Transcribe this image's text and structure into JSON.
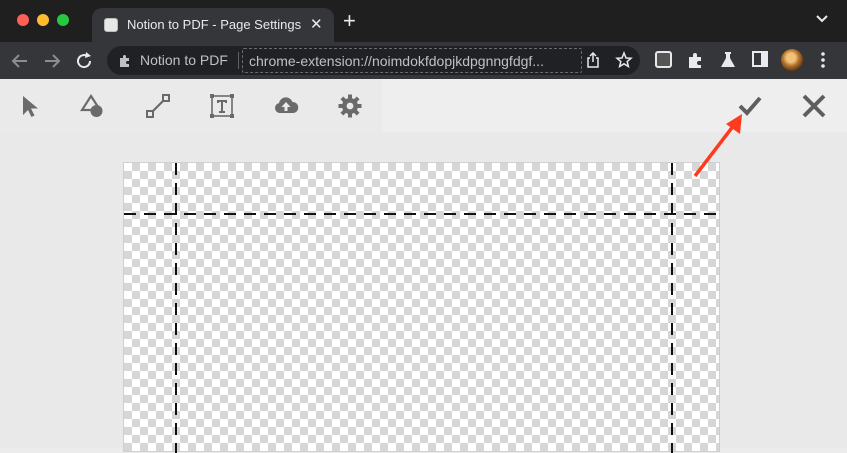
{
  "browser": {
    "tab": {
      "title": "Notion to PDF - Page Settings"
    },
    "omnibox": {
      "site_chip": "Notion to PDF",
      "url": "chrome-extension://noimdokfdopjkdpgnngfdgf..."
    }
  },
  "app_toolbar": {
    "tools": [
      {
        "name": "select-tool",
        "icon": "cursor-arrow-icon"
      },
      {
        "name": "shape-tool",
        "icon": "shapes-icon"
      },
      {
        "name": "line-tool",
        "icon": "line-icon"
      },
      {
        "name": "text-tool",
        "icon": "text-box-icon"
      },
      {
        "name": "upload-tool",
        "icon": "cloud-upload-icon"
      },
      {
        "name": "settings-tool",
        "icon": "gear-icon"
      }
    ],
    "actions": [
      {
        "name": "confirm-button",
        "icon": "check-icon"
      },
      {
        "name": "close-button",
        "icon": "x-icon"
      }
    ]
  },
  "colors": {
    "annotation_arrow": "#ff3b1f",
    "tab_active": "#35363a",
    "titlebar": "#1f1f1f"
  }
}
